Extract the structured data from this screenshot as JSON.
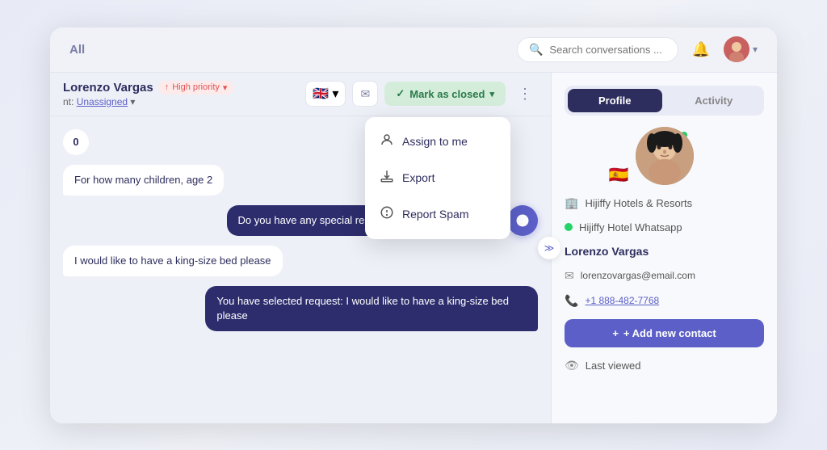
{
  "topbar": {
    "title": "All",
    "search_placeholder": "Search conversations ...",
    "chevron": "▾"
  },
  "chat": {
    "contact_name": "Lorenzo Vargas",
    "priority_label": "High priority",
    "assign_label": "nt: ",
    "assign_link": "Unassigned",
    "flag_emoji": "🇬🇧",
    "mark_closed_label": "Mark as closed",
    "messages": [
      {
        "text": "For how many children, age 2",
        "type": "incoming"
      },
      {
        "text": "Do you have any special request for your reservation?",
        "type": "outgoing"
      },
      {
        "text": "I would like to have a king-size bed please",
        "type": "incoming"
      },
      {
        "text": "You have selected request: I would like to have a king-size bed please",
        "type": "outgoing"
      }
    ],
    "counter": "0"
  },
  "dropdown": {
    "items": [
      {
        "label": "Assign to me",
        "icon": "👤"
      },
      {
        "label": "Export",
        "icon": "⬇"
      },
      {
        "label": "Report Spam",
        "icon": "⚠"
      }
    ]
  },
  "panel": {
    "tabs": [
      {
        "label": "Profile",
        "active": true
      },
      {
        "label": "Activity",
        "active": false
      }
    ],
    "company": "Hijiffy Hotels & Resorts",
    "channel_label": "Hijiffy Hotel Whatsapp",
    "contact_name": "Lorenzo Vargas",
    "email": "lorenzovargas@email.com",
    "phone": "+1 888-482-7768",
    "add_contact_label": "+ Add new contact",
    "last_viewed_label": "Last viewed"
  }
}
